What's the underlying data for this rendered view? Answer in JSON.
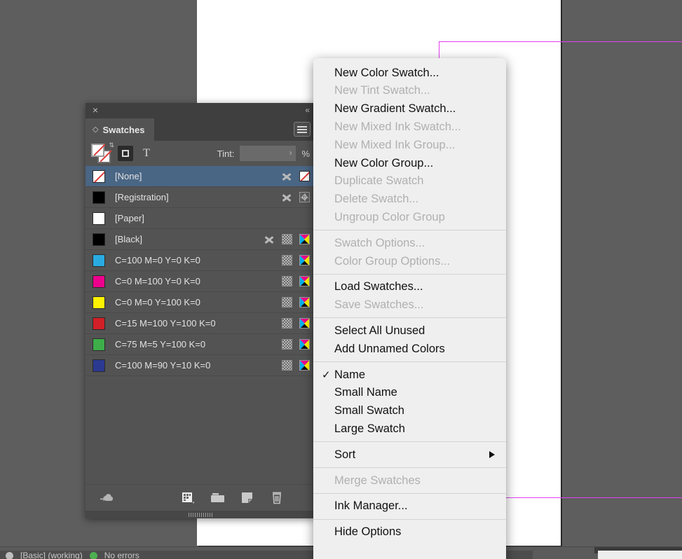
{
  "app": {
    "document_background": "#5e5e5e",
    "page_color": "#ffffff",
    "margin_guide_color": "#e13ff0"
  },
  "panel": {
    "title": "Swatches",
    "close_icon": "×",
    "collapse_icon": "«",
    "menu_button_name": "panel-menu-button",
    "options": {
      "tint_label": "Tint:",
      "tint_value": "",
      "tint_placeholder": "",
      "percent_symbol": "%",
      "formatting_frame_title": "Formatting affects container",
      "formatting_text_title": "Formatting affects text",
      "text_button_glyph": "T"
    },
    "columns": [
      "swatch",
      "name",
      "spot",
      "color-space"
    ],
    "swatches": [
      {
        "name": "[None]",
        "color": "#ffffff",
        "type": "none",
        "selected": true,
        "icons": [
          "spot",
          "none"
        ]
      },
      {
        "name": "[Registration]",
        "color": "#000000",
        "type": "registration",
        "selected": false,
        "icons": [
          "spot",
          "registration"
        ]
      },
      {
        "name": "[Paper]",
        "color": "#ffffff",
        "type": "paper",
        "selected": false,
        "icons": []
      },
      {
        "name": "[Black]",
        "color": "#000000",
        "type": "process",
        "selected": false,
        "icons": [
          "spot",
          "tint",
          "cmyk"
        ]
      },
      {
        "name": "C=100 M=0 Y=0 K=0",
        "color": "#29abe2",
        "type": "process",
        "selected": false,
        "icons": [
          "tint",
          "cmyk"
        ]
      },
      {
        "name": "C=0 M=100 Y=0 K=0",
        "color": "#ec008c",
        "type": "process",
        "selected": false,
        "icons": [
          "tint",
          "cmyk"
        ]
      },
      {
        "name": "C=0 M=0 Y=100 K=0",
        "color": "#fff200",
        "type": "process",
        "selected": false,
        "icons": [
          "tint",
          "cmyk"
        ]
      },
      {
        "name": "C=15 M=100 Y=100 K=0",
        "color": "#d12027",
        "type": "process",
        "selected": false,
        "icons": [
          "tint",
          "cmyk"
        ]
      },
      {
        "name": "C=75 M=5 Y=100 K=0",
        "color": "#3dae49",
        "type": "process",
        "selected": false,
        "icons": [
          "tint",
          "cmyk"
        ]
      },
      {
        "name": "C=100 M=90 Y=10 K=0",
        "color": "#2b3990",
        "type": "process",
        "selected": false,
        "icons": [
          "tint",
          "cmyk"
        ]
      }
    ],
    "footer_buttons": [
      {
        "name": "save-to-cc-libraries",
        "icon": "cloud-icon"
      },
      {
        "name": "color-theme-tool",
        "icon": "color-theme-icon"
      },
      {
        "name": "new-color-group",
        "icon": "folder-icon"
      },
      {
        "name": "new-swatch",
        "icon": "new-swatch-icon"
      },
      {
        "name": "delete-swatch",
        "icon": "trash-icon"
      }
    ]
  },
  "flyout_menu": {
    "items": [
      {
        "label": "New Color Swatch...",
        "enabled": true,
        "checked": false,
        "submenu": false
      },
      {
        "label": "New Tint Swatch...",
        "enabled": false,
        "checked": false,
        "submenu": false
      },
      {
        "label": "New Gradient Swatch...",
        "enabled": true,
        "checked": false,
        "submenu": false
      },
      {
        "label": "New Mixed Ink Swatch...",
        "enabled": false,
        "checked": false,
        "submenu": false
      },
      {
        "label": "New Mixed Ink Group...",
        "enabled": false,
        "checked": false,
        "submenu": false
      },
      {
        "label": "New Color Group...",
        "enabled": true,
        "checked": false,
        "submenu": false
      },
      {
        "label": "Duplicate Swatch",
        "enabled": false,
        "checked": false,
        "submenu": false
      },
      {
        "label": "Delete Swatch...",
        "enabled": false,
        "checked": false,
        "submenu": false
      },
      {
        "label": "Ungroup Color Group",
        "enabled": false,
        "checked": false,
        "submenu": false
      },
      {
        "separator": true
      },
      {
        "label": "Swatch Options...",
        "enabled": false,
        "checked": false,
        "submenu": false
      },
      {
        "label": "Color Group Options...",
        "enabled": false,
        "checked": false,
        "submenu": false
      },
      {
        "separator": true
      },
      {
        "label": "Load Swatches...",
        "enabled": true,
        "checked": false,
        "submenu": false
      },
      {
        "label": "Save Swatches...",
        "enabled": false,
        "checked": false,
        "submenu": false
      },
      {
        "separator": true
      },
      {
        "label": "Select All Unused",
        "enabled": true,
        "checked": false,
        "submenu": false
      },
      {
        "label": "Add Unnamed Colors",
        "enabled": true,
        "checked": false,
        "submenu": false
      },
      {
        "separator": true
      },
      {
        "label": "Name",
        "enabled": true,
        "checked": true,
        "submenu": false
      },
      {
        "label": "Small Name",
        "enabled": true,
        "checked": false,
        "submenu": false
      },
      {
        "label": "Small Swatch",
        "enabled": true,
        "checked": false,
        "submenu": false
      },
      {
        "label": "Large Swatch",
        "enabled": true,
        "checked": false,
        "submenu": false
      },
      {
        "separator": true
      },
      {
        "label": "Sort",
        "enabled": true,
        "checked": false,
        "submenu": true
      },
      {
        "separator": true
      },
      {
        "label": "Merge Swatches",
        "enabled": false,
        "checked": false,
        "submenu": false
      },
      {
        "separator": true
      },
      {
        "label": "Ink Manager...",
        "enabled": true,
        "checked": false,
        "submenu": false
      },
      {
        "separator": true
      },
      {
        "label": "Hide Options",
        "enabled": true,
        "checked": false,
        "submenu": false
      }
    ],
    "check_glyph": "✓",
    "submenu_glyph": "►"
  },
  "status_bar": {
    "items": [
      "[Basic] (working)",
      "No errors"
    ]
  }
}
